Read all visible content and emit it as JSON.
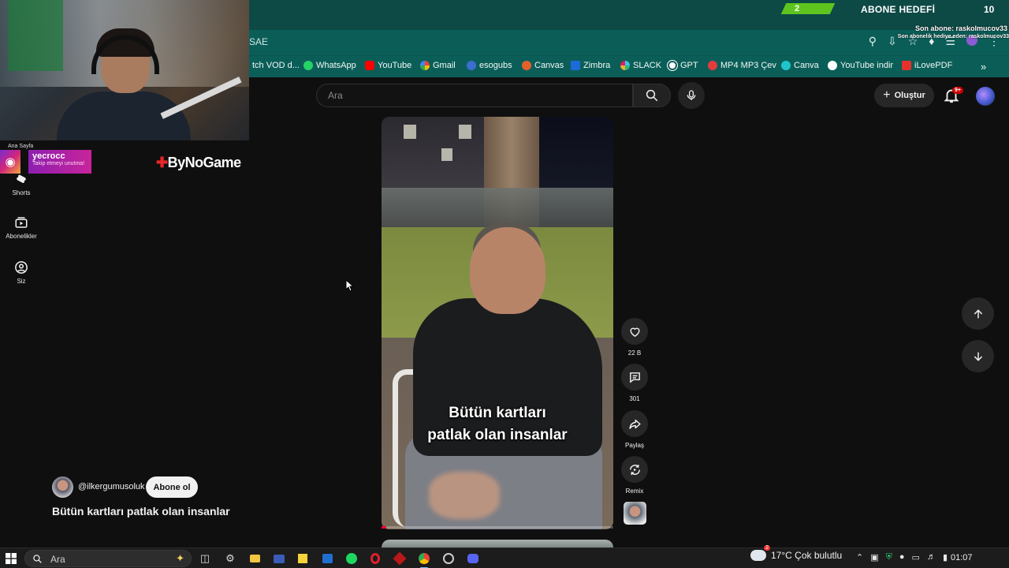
{
  "browser": {
    "url_fragment": "SAE",
    "bookmarks": [
      {
        "label": "tch VOD d...",
        "icon": "twitch-icon",
        "color": "#9146ff"
      },
      {
        "label": "WhatsApp",
        "icon": "whatsapp-icon",
        "color": "#25d366"
      },
      {
        "label": "YouTube",
        "icon": "youtube-icon",
        "color": "#ff0000"
      },
      {
        "label": "Gmail",
        "icon": "google-icon",
        "color": "#ea4335"
      },
      {
        "label": "esogubs",
        "icon": "globe-icon",
        "color": "#3b6ecf"
      },
      {
        "label": "Canvas",
        "icon": "canvas-icon",
        "color": "#e2612b"
      },
      {
        "label": "Zimbra",
        "icon": "zimbra-icon",
        "color": "#1c6bd6"
      },
      {
        "label": "SLACK",
        "icon": "slack-icon",
        "color": "#e01e5a"
      },
      {
        "label": "GPT",
        "icon": "openai-icon",
        "color": "#ffffff"
      },
      {
        "label": "MP4 MP3 Çev",
        "icon": "converter-icon",
        "color": "#e23c3c"
      },
      {
        "label": "Canva",
        "icon": "canva-icon",
        "color": "#20c4cb"
      },
      {
        "label": "YouTube indir",
        "icon": "globe-icon",
        "color": "#ffffff"
      },
      {
        "label": "iLovePDF",
        "icon": "ilovepdf-icon",
        "color": "#e5322d"
      }
    ]
  },
  "stream_overlay": {
    "instagram_user": "yecrocc",
    "instagram_sub": "Takip etmeyi unutma!",
    "sponsor": "ByNoGame",
    "abone_current": "2",
    "abone_title": "ABONE HEDEFİ",
    "abone_goal": "10",
    "son_abone": "Son abone: raskolmucov33",
    "son_hediye": "Son abonelik hediye eden: raskolmucov33"
  },
  "youtube": {
    "search_placeholder": "Ara",
    "create_label": "Oluştur",
    "notification_count": "9+",
    "sidebar": {
      "home_label": "Ana Sayfa",
      "items": [
        {
          "label": "Shorts",
          "icon": "shorts-icon"
        },
        {
          "label": "Abonelikler",
          "icon": "subscriptions-icon"
        },
        {
          "label": "Siz",
          "icon": "user-icon"
        }
      ]
    },
    "short": {
      "caption_line1": "Bütün kartları",
      "caption_line2": "patlak olan insanlar",
      "title": "Bütün kartları patlak olan insanlar",
      "channel_handle": "@ilkergumusoluk",
      "subscribe_label": "Abone ol",
      "progress": 0.02
    },
    "actions": {
      "likes": "22 B",
      "comments": "301",
      "share": "Paylaş",
      "remix": "Remix"
    }
  },
  "taskbar": {
    "search_placeholder": "Ara",
    "weather": "17°C  Çok bulutlu",
    "weather_badge": "2",
    "time": "01:07"
  }
}
